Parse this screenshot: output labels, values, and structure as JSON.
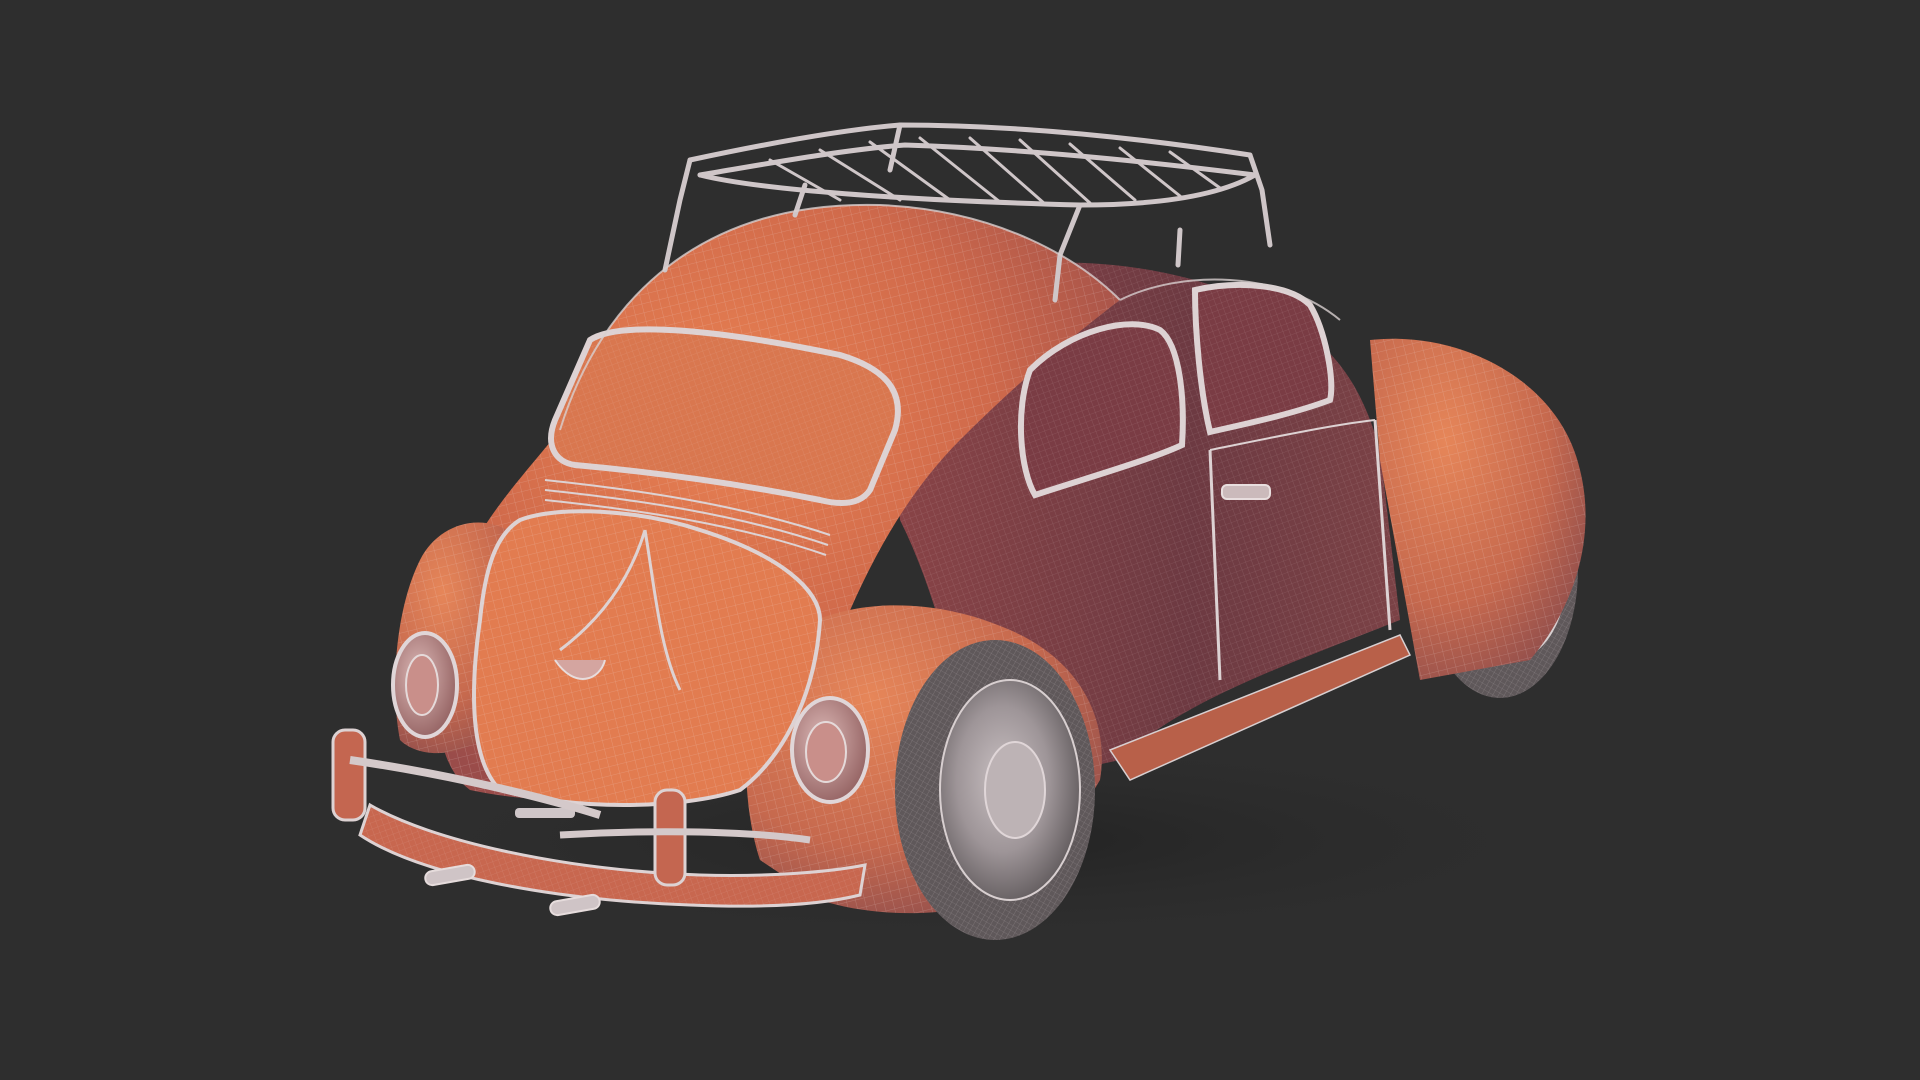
{
  "scene": {
    "subject": "car-wireframe-render",
    "background_color": "#2e2e2e",
    "colors": {
      "body_light": "#e07a4d",
      "body_mid": "#c9664a",
      "body_dark": "#7d3d43",
      "side_panel": "#6e3a42",
      "window_glass": "#8a4046",
      "wire": "#d8cfd0",
      "tire": "#6a6466",
      "tire_dark": "#4a4446",
      "hubcap": "#b9b0b2",
      "roof_rack": "#cfc6c8",
      "bumper": "#c8674f",
      "shadow": "#242424"
    }
  }
}
